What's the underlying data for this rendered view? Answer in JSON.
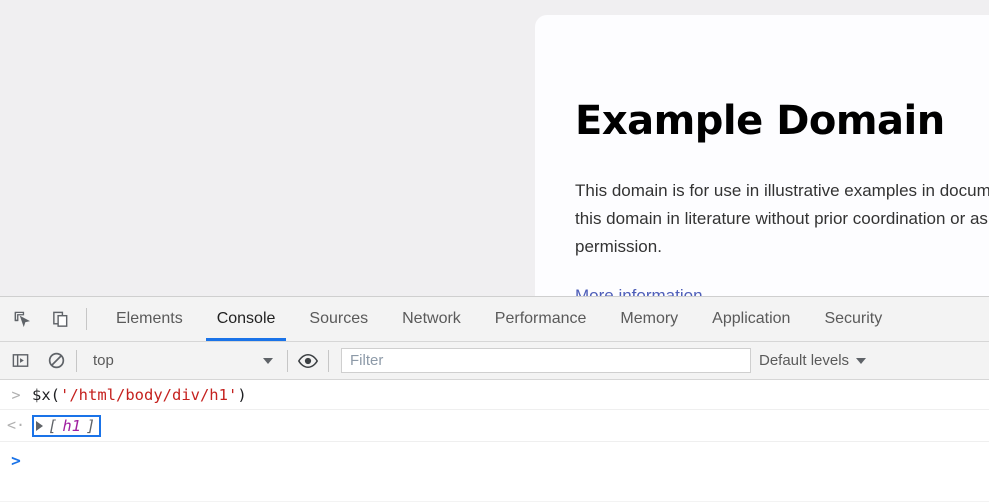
{
  "page": {
    "title": "Example Domain",
    "paragraph": "This domain is for use in illustrative examples in documents. You may use this domain in literature without prior coordination or asking for permission.",
    "link_label": "More information..."
  },
  "devtools": {
    "tabstrip": {
      "inspect_icon": "inspect-element-icon",
      "device_toolbar_icon": "device-toolbar-icon",
      "tabs": [
        {
          "label": "Elements",
          "active": false
        },
        {
          "label": "Console",
          "active": true
        },
        {
          "label": "Sources",
          "active": false
        },
        {
          "label": "Network",
          "active": false
        },
        {
          "label": "Performance",
          "active": false
        },
        {
          "label": "Memory",
          "active": false
        },
        {
          "label": "Application",
          "active": false
        },
        {
          "label": "Security",
          "active": false
        }
      ]
    },
    "console_toolbar": {
      "sidebar_icon": "console-sidebar-icon",
      "clear_icon": "clear-console-icon",
      "context_value": "top",
      "context_caret": "chevron-down-icon",
      "eye_icon": "live-expression-eye-icon",
      "filter_value": "",
      "filter_placeholder": "Filter",
      "levels_label": "Default levels",
      "levels_caret": "chevron-down-icon"
    },
    "console_rows": [
      {
        "gutter": ">",
        "type": "input",
        "tokens": [
          {
            "text": "$x(",
            "cls": "tok-plain"
          },
          {
            "text": "'/html/body/div/h1'",
            "cls": "tok-string"
          },
          {
            "text": ")",
            "cls": "tok-plain"
          }
        ]
      },
      {
        "gutter": "<·",
        "type": "result",
        "disclosure": "expand-triangle-icon",
        "tokens": [
          {
            "text": "[",
            "cls": "tok-bracket"
          },
          {
            "text": "h1",
            "cls": "tok-node"
          },
          {
            "text": "]",
            "cls": "tok-bracket"
          }
        ]
      }
    ],
    "prompt": {
      "chevron": ">",
      "value": ""
    }
  },
  "colors": {
    "accent_blue": "#1a73e8",
    "page_bg": "#f0eff1",
    "devtools_bg": "#f3f3f3",
    "string_red": "#c5221f",
    "node_purple": "#a020a0",
    "link_purple": "#4e5eb8"
  }
}
